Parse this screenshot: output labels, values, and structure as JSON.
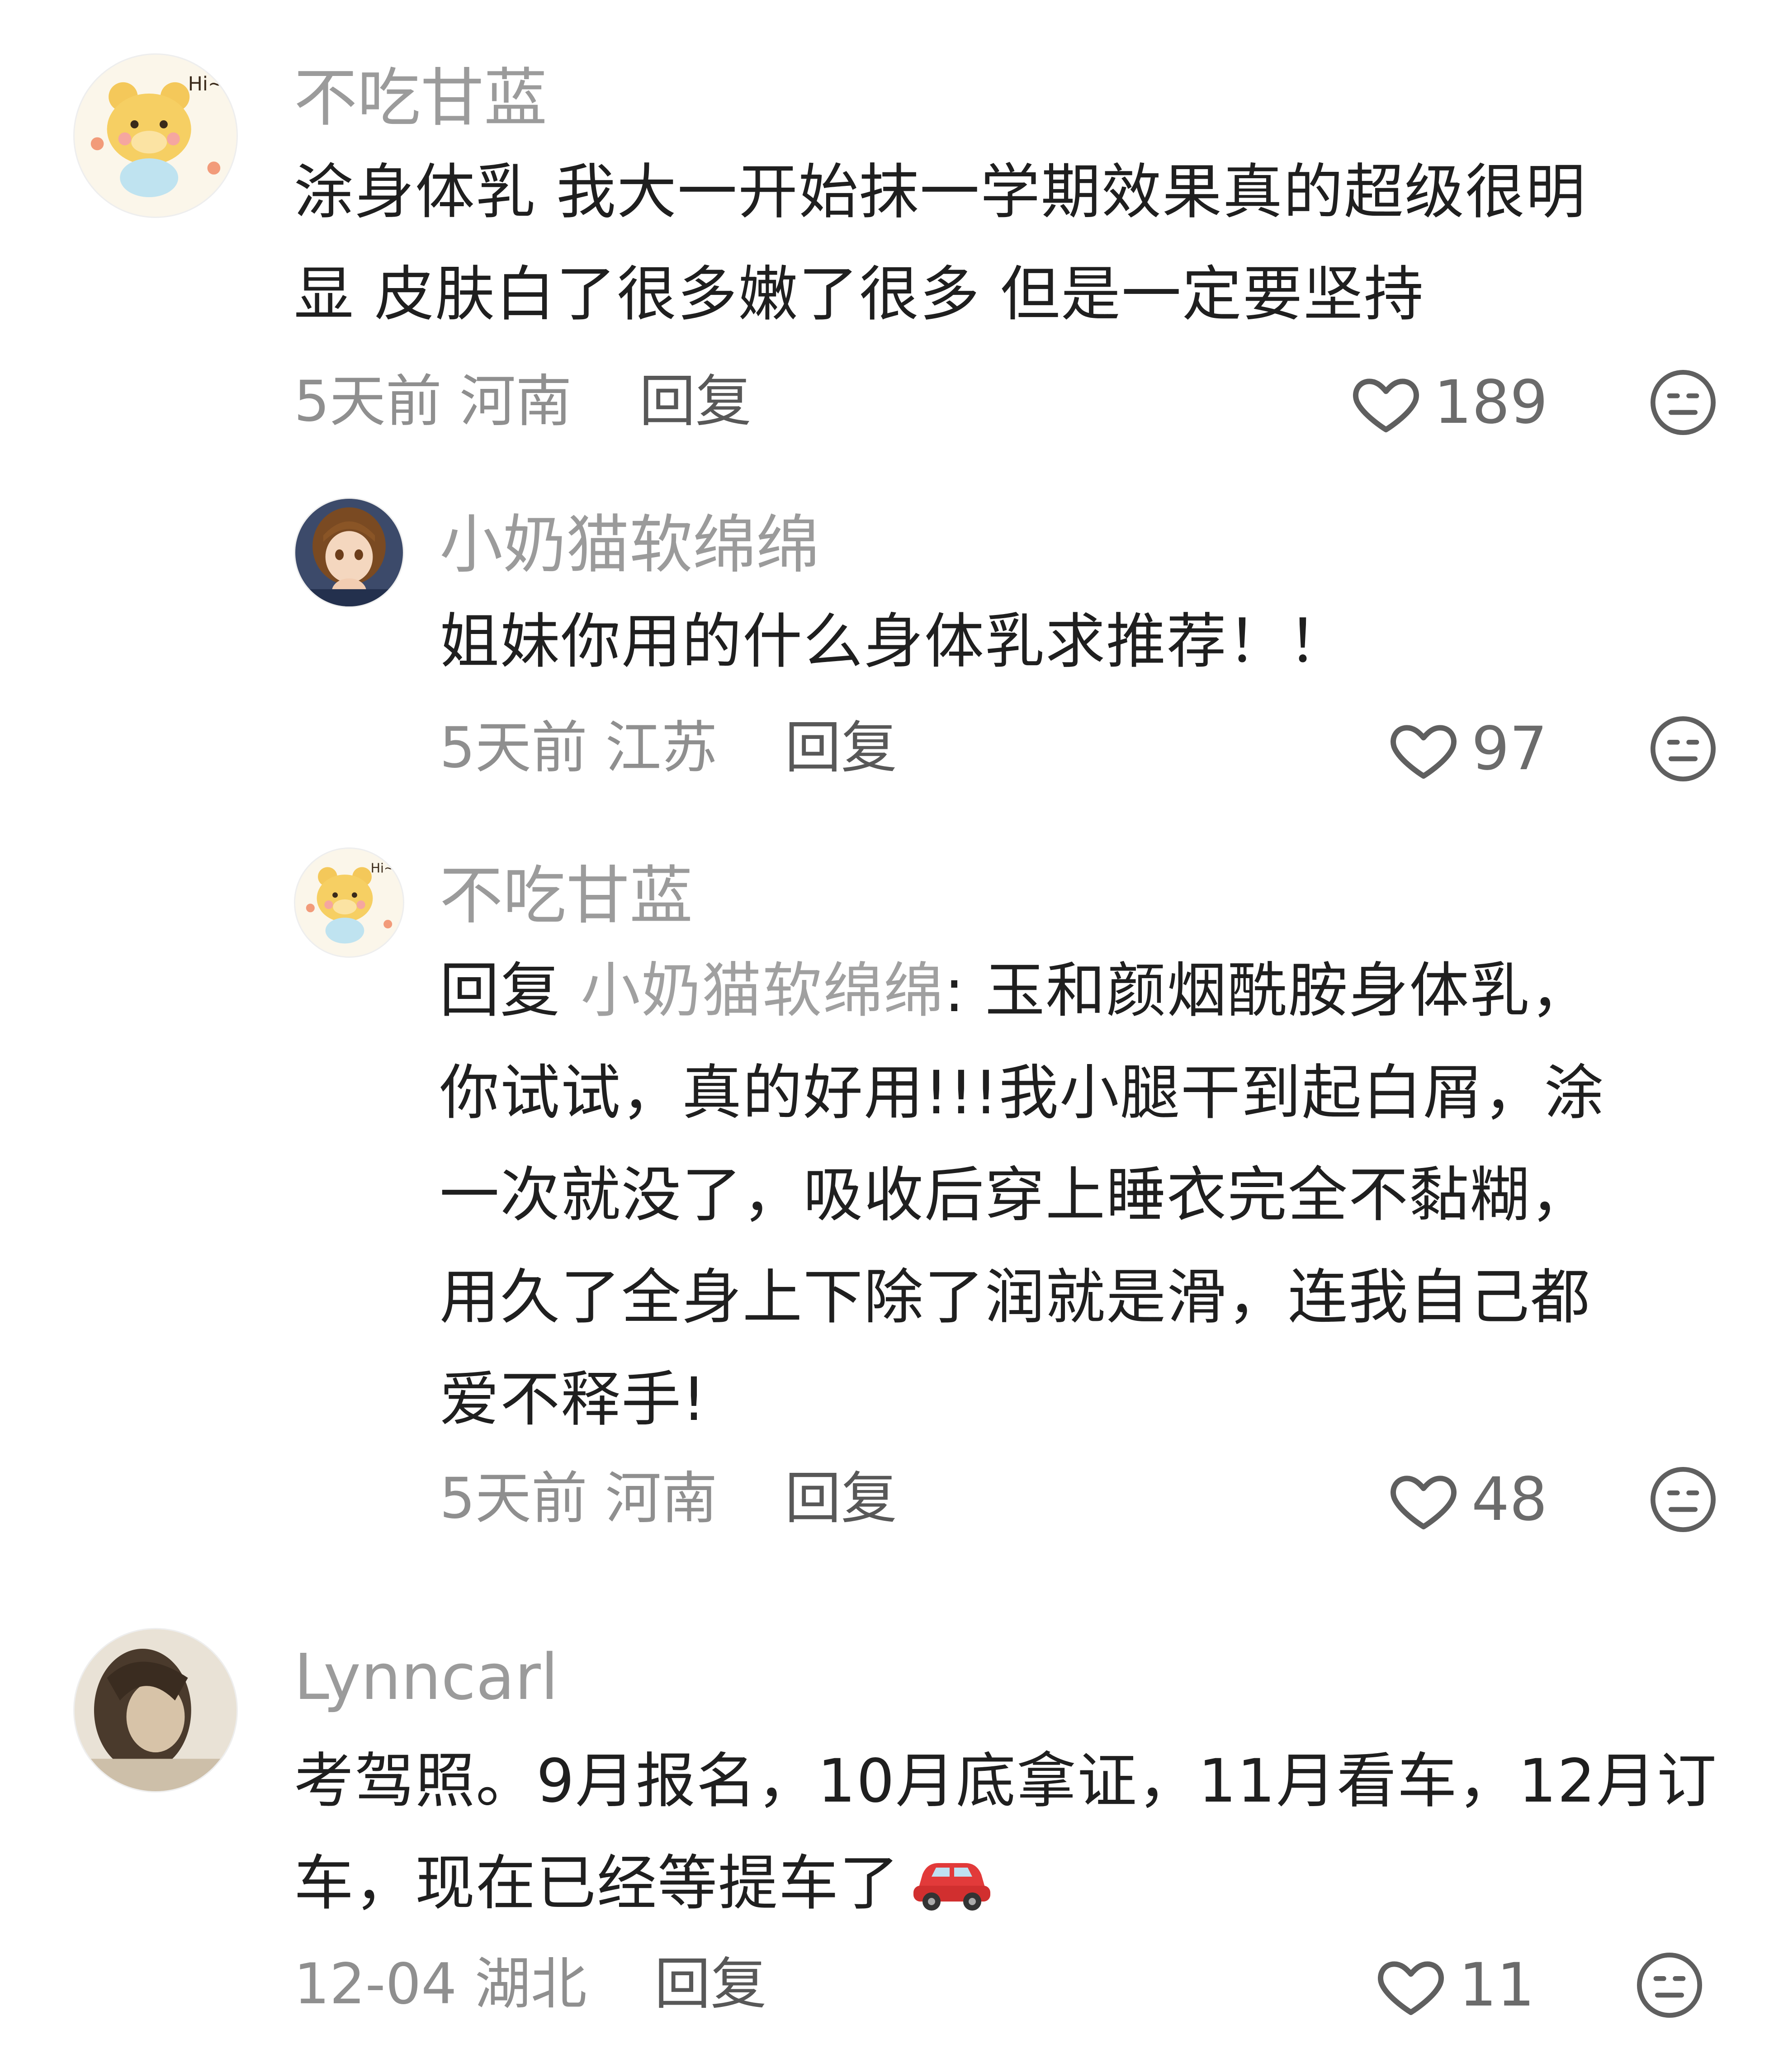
{
  "comments": [
    {
      "username": "不吃甘蓝",
      "avatar_icon": "bear-hi-avatar-icon",
      "text_line1": "涂身体乳 我大一开始抹一学期效果真的超级很明",
      "text_line2": "显 皮肤白了很多嫩了很多 但是一定要坚持",
      "time": "5天前",
      "location": "河南",
      "reply_label": "回复",
      "likes": "189"
    },
    {
      "username": "小奶猫软绵绵",
      "avatar_icon": "anime-girl-avatar-icon",
      "text_line1": "姐妹你用的什么身体乳求推荐！！",
      "time": "5天前",
      "location": "江苏",
      "reply_label": "回复",
      "likes": "97"
    },
    {
      "username": "不吃甘蓝",
      "avatar_icon": "bear-hi-avatar-icon",
      "reply_prefix": "回复 ",
      "reply_to": "小奶猫软绵绵",
      "reply_sep": ": ",
      "text_line1": "玉和颜烟酰胺身体乳，",
      "text_line2": "你试试，真的好用!!!我小腿干到起白屑，涂",
      "text_line3": "一次就没了，吸收后穿上睡衣完全不黏糊，",
      "text_line4": "用久了全身上下除了润就是滑，连我自己都",
      "text_line5": "爱不释手!",
      "time": "5天前",
      "location": "河南",
      "reply_label": "回复",
      "likes": "48"
    },
    {
      "username": "Lynncarl",
      "avatar_icon": "portrait-photo-avatar-icon",
      "text_line1": "考驾照。9月报名，10月底拿证，11月看车，12月订",
      "text_line2": "车，现在已经等提车了",
      "emoji": "car-emoji-icon",
      "time": "12-04",
      "location": "湖北",
      "reply_label": "回复",
      "likes": "11"
    }
  ],
  "icons": {
    "like": "heart-outline-icon",
    "dislike": "neutral-face-icon"
  },
  "colors": {
    "username": "#9b9b9b",
    "text": "#1f1f1f",
    "meta": "#8f8f8f",
    "car": "#e23a3a"
  }
}
